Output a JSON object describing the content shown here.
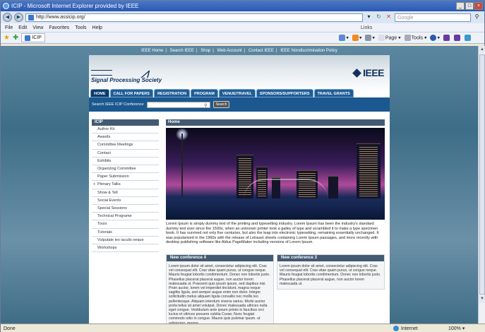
{
  "window": {
    "title": "ICIP - Microsoft Internet Explorer provided by IEEE"
  },
  "address": {
    "url": "http://www.assicip.org/",
    "search_placeholder": "Google"
  },
  "menubar": {
    "items": [
      "File",
      "Edit",
      "View",
      "Favorites",
      "Tools",
      "Help"
    ],
    "links": "Links"
  },
  "tab": {
    "label": "ICIP"
  },
  "commands": {
    "page": "Page ▾",
    "tools": "Tools ▾"
  },
  "status": {
    "left": "Done",
    "zone": "Internet",
    "zoom": "100% ▾"
  },
  "site": {
    "toplinks": [
      "IEEE Home",
      "Search IEEE",
      "Shop",
      "Web Account",
      "Contact IEEE",
      "IEEE Nondiscrimination Policy"
    ],
    "sps_name": "Signal Processing Society",
    "ieee": "IEEE",
    "menu": [
      "HOME",
      "CALL FOR PAPERS",
      "REGISTRATION",
      "PROGRAM",
      "VENUE/TRAVEL",
      "SPONSORS/SUPPORTERS",
      "TRAVEL GRANTS"
    ],
    "search_label": "Search IEEE ICIP Conference",
    "search_button": "Search",
    "sidebar_title": "ICIP",
    "sidebar": [
      "Author Kit",
      "Awards",
      "Committee Meetings",
      "Contact",
      "Exhibits",
      "Organizing Committee",
      "Paper Submission",
      "Plenary Talks",
      "Show & Tell",
      "Social Events",
      "Special Sessions",
      "Technical Programe",
      "Tours",
      "Tutorials",
      "Vulputate leo iaculis neque",
      "Workshops"
    ],
    "home_title": "Home",
    "intro": "Lorem Ipsum is simply dummy text of the printing and typesetting industry. Lorem Ipsum has been the industry's standard dummy text ever since the 1500s, when an unknown printer took a galley of type and scrambled it to make a type specimen book. It has survived not only five centuries, but also the leap into electronic typesetting, remaining essentially unchanged. It was popularised in the 1960s with the release of Letraset sheets containing Lorem Ipsum passages, and more recently with desktop publishing software like Aldus PageMaker including versions of Lorem Ipsum.",
    "box1_title": "New conference 4",
    "box1_text": "Lorem ipsum dolor sit amet, consectetur adipiscing elit. Cras vel consequat elit. Cras vitae quam purus, ut congue neque. Mauris feugiat lobortis condimentum. Donec non lobortis justo. Phasellus placerat placerat augue, non auctor lorem malesuada ut. Praesent quis ipsum ipsum, sed dapibus nisi. Proin auctor, lorem vel imperdiet tincidunt, magna neque sagittis ligula, sed semper augue enim non dolor. Integer sollicitudin metus aliquam ligula convallis nec mollis leo pellentesque. Aliquam interdum viverra varius. Morbi auctor porta tellus sit amet volutpat. Donec malesuada ultrices nulla eget congue. Vestibulum ante ipsum primis in faucibus orci luctus et ultrices posuere cubilia Curae; Nunc feugiat commodo odio in congue. Mauris quis pulvinar ipsum. ut adipiscing, magna",
    "box2_title": "New conference 3",
    "box2_text": "Lorem ipsum dolor sit amet, consectetur adipiscing elit. Cras vel consequat elit. Cras vitae quam purus, ut congue neque. Mauris feugiat lobortis condimentum. Donec non lobortis justo. Phasellus placerat placerat augue, non auctor lorem malesuada ut."
  }
}
